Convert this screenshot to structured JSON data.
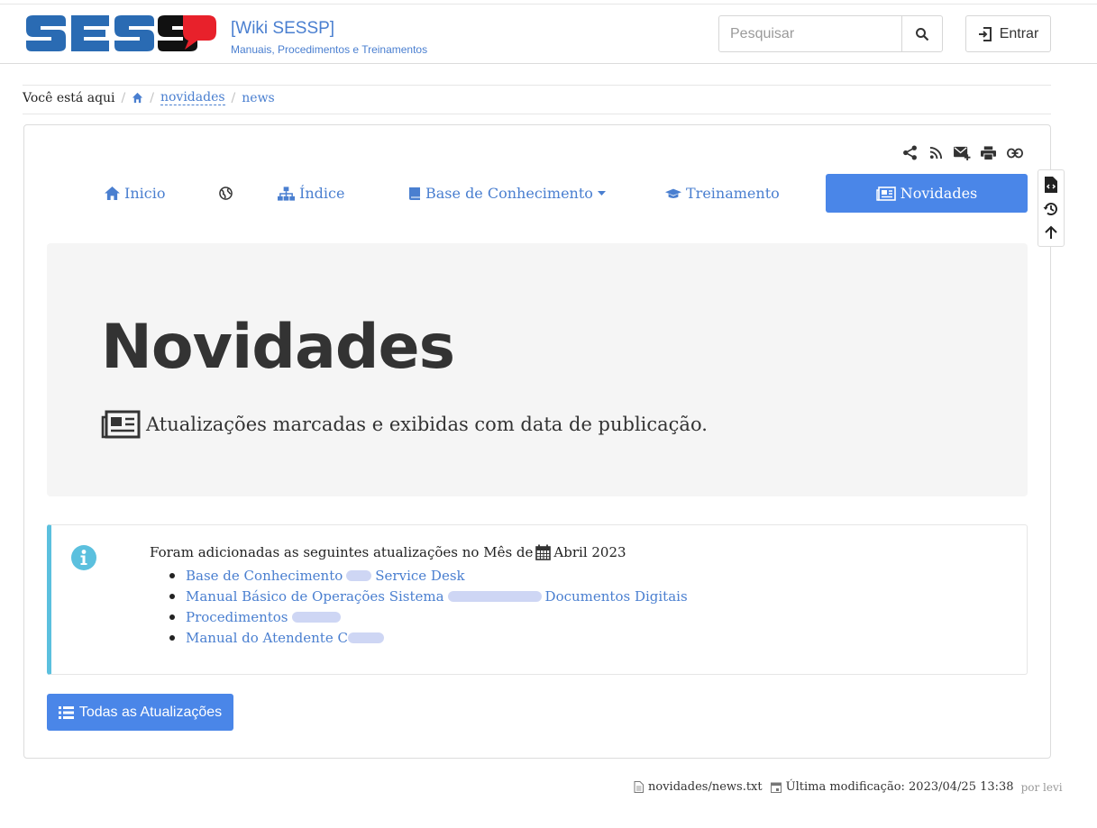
{
  "header": {
    "site_title": "[Wiki SESSP]",
    "tagline": "Manuais, Procedimentos e Treinamentos",
    "search_placeholder": "Pesquisar",
    "login_label": "Entrar",
    "logo_colors": {
      "primary": "#2a6bb3",
      "secondary": "#111111",
      "accent": "#e8212b"
    }
  },
  "breadcrumb": {
    "prefix": "Você está aqui",
    "home_icon": "home-icon",
    "items": [
      "novidades",
      "news"
    ]
  },
  "page_tools": [
    "share-icon",
    "rss-icon",
    "mail-icon",
    "print-icon",
    "link-icon"
  ],
  "side_tools": [
    "source-icon",
    "history-icon",
    "back-to-top-icon"
  ],
  "nav": {
    "items": [
      {
        "label": "Inicio",
        "icon": "home-icon"
      },
      {
        "label": "",
        "icon": "globe-icon"
      },
      {
        "label": "Índice",
        "icon": "sitemap-icon"
      },
      {
        "label": "Base de Conhecimento",
        "icon": "book-icon",
        "dropdown": true
      },
      {
        "label": "Treinamento",
        "icon": "graduation-cap-icon"
      },
      {
        "label": "Novidades",
        "icon": "newspaper-icon",
        "active": true
      }
    ]
  },
  "hero": {
    "title": "Novidades",
    "subtitle": "Atualizações marcadas e exibidas com data de publicação."
  },
  "info": {
    "intro": "Foram adicionadas as seguintes atualizações no Mês de",
    "date": "Abril 2023",
    "items": [
      {
        "before": "Base de Conhecimento",
        "after": "Service Desk"
      },
      {
        "before": "Manual Básico de Operações Sistema",
        "after": "Documentos Digitais"
      },
      {
        "before": "Procedimentos",
        "after": ""
      },
      {
        "before": "Manual do Atendente C",
        "after": ""
      }
    ]
  },
  "all_updates_label": "Todas as Atualizações",
  "footer": {
    "file": "novidades/news.txt",
    "modified": "Última modificação: 2023/04/25 13:38",
    "by": "por levi"
  },
  "colors": {
    "link": "#4a7fd0",
    "primary_button": "#4a86e8",
    "info_border": "#5bc0de",
    "hero_bg": "#f5f5f5"
  }
}
